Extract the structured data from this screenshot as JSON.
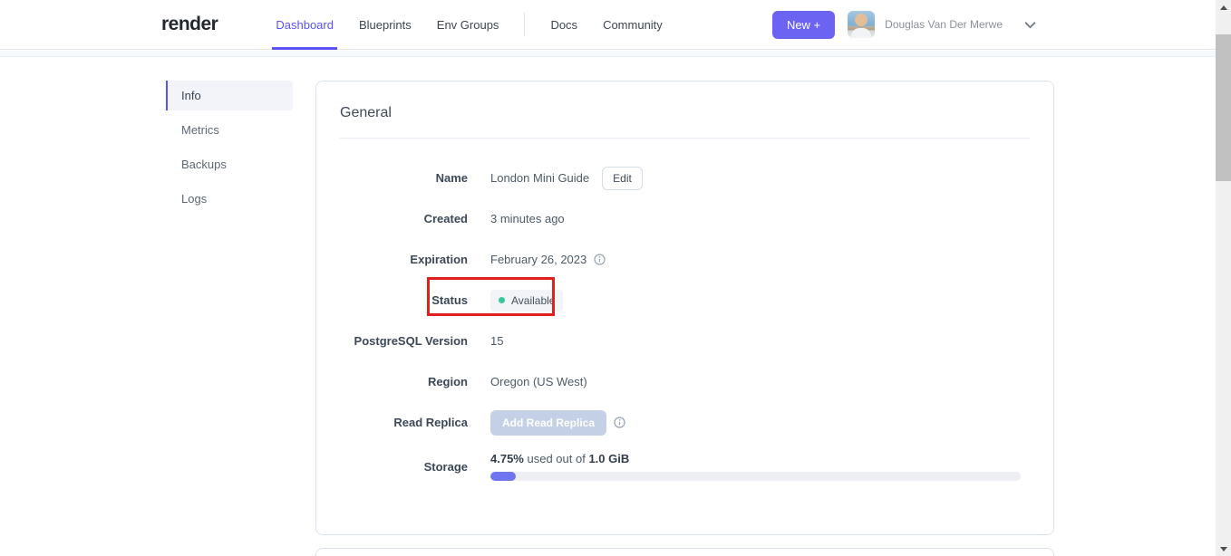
{
  "colors": {
    "accent": "#5A54F4",
    "new_button_bg": "#6C63F2",
    "annotation_red": "#E02020",
    "status_dot_green": "#34C89A",
    "progress_fill": "#6F75F1"
  },
  "header": {
    "logo": "render",
    "nav": [
      {
        "label": "Dashboard",
        "active": true
      },
      {
        "label": "Blueprints",
        "active": false
      },
      {
        "label": "Env Groups",
        "active": false
      },
      {
        "label": "Docs",
        "active": false
      },
      {
        "label": "Community",
        "active": false
      }
    ],
    "new_button_label": "New +",
    "user_name": "Douglas Van Der Merwe"
  },
  "sidebar": {
    "items": [
      {
        "label": "Info",
        "active": true
      },
      {
        "label": "Metrics",
        "active": false
      },
      {
        "label": "Backups",
        "active": false
      },
      {
        "label": "Logs",
        "active": false
      }
    ]
  },
  "panel": {
    "title": "General",
    "rows": {
      "name": {
        "label": "Name",
        "value": "London Mini Guide",
        "edit_button": "Edit"
      },
      "created": {
        "label": "Created",
        "value": "3 minutes ago"
      },
      "expiration": {
        "label": "Expiration",
        "value": "February 26, 2023"
      },
      "status": {
        "label": "Status",
        "badge": "Available"
      },
      "version": {
        "label": "PostgreSQL Version",
        "value": "15"
      },
      "region": {
        "label": "Region",
        "value": "Oregon (US West)"
      },
      "read_replica": {
        "label": "Read Replica",
        "button": "Add Read Replica"
      },
      "storage": {
        "label": "Storage",
        "used_pct": "4.75%",
        "middle_text": " used out of ",
        "total": "1.0 GiB",
        "progress_width": "4.75%"
      }
    }
  }
}
